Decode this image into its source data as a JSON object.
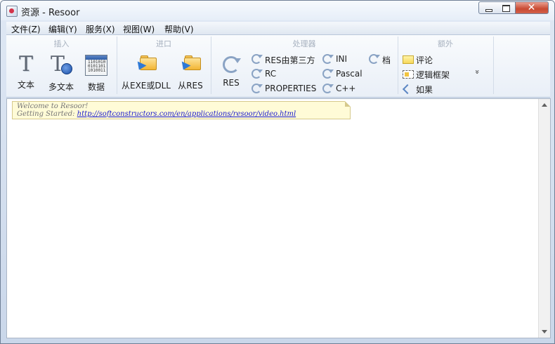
{
  "window": {
    "title": "资源 - Resoor"
  },
  "menu": [
    "文件(Z)",
    "编辑(Y)",
    "服务(X)",
    "视图(W)",
    "帮助(V)"
  ],
  "ribbon": {
    "insert": {
      "title": "插入",
      "text": "文本",
      "multitext": "多文本",
      "data": "数据"
    },
    "import": {
      "title": "进口",
      "from_exe": "从EXE或DLL",
      "from_res": "从RES"
    },
    "processors": {
      "title": "处理器",
      "res": "RES",
      "res_third": "RES由第三方",
      "rc": "RC",
      "properties": "PROPERTIES",
      "ini": "INI",
      "pascal": "Pascal",
      "cpp": "C++",
      "archive": "档"
    },
    "extra": {
      "title": "额外",
      "comment": "评论",
      "logic_frame": "逻辑框架",
      "if": "如果",
      "more": "»"
    }
  },
  "editor": {
    "note_line1": "Welcome to Resoor!",
    "note_line2_label": "Getting Started: ",
    "note_link": "http://softconstructors.com/en/applications/resoor/video.html"
  }
}
